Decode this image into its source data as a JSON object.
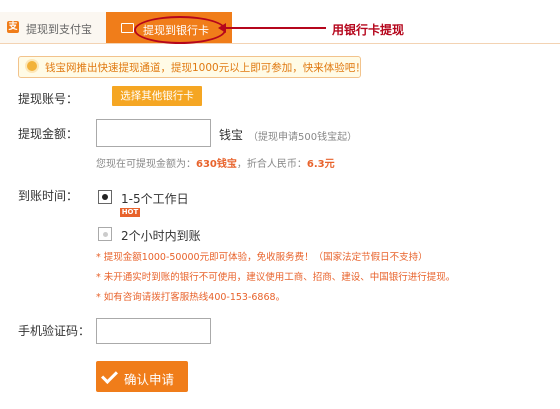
{
  "tabs": {
    "alipay": {
      "label": "提现到支付宝",
      "icon": "alipay-icon"
    },
    "bank": {
      "label": "提现到银行卡",
      "icon": "bank-card-icon",
      "active": true
    }
  },
  "annotation": {
    "text": "用银行卡提现",
    "color": "#b5061c"
  },
  "notice": {
    "text": "钱宝网推出快速提现通道，提现1000元以上即可参加，快来体验吧！",
    "icon": "sun-icon"
  },
  "form": {
    "account": {
      "label": "提现账号：",
      "button": "选择其他银行卡"
    },
    "amount": {
      "label": "提现金额：",
      "value": "",
      "unit": "钱宝",
      "hint": "（提现申请500钱宝起）",
      "available_prefix": "您现在可提现金额为：",
      "available_value": "630钱宝",
      "rmb_prefix": "，折合人民币：",
      "rmb_value": "6.3元"
    },
    "arrival": {
      "label": "到账时间：",
      "options": [
        {
          "label": "1-5个工作日",
          "selected": true,
          "badge": "HOT"
        },
        {
          "label": "2个小时内到账",
          "selected": false
        }
      ],
      "rules": [
        "* 提现金额1000-50000元即可体验，免收服务费！（国家法定节假日不支持）",
        "* 未开通实时到账的银行不可使用，建议使用工商、招商、建设、中国银行进行提现。",
        "* 如有咨询请拨打客服热线400-153-6868。"
      ]
    },
    "sms": {
      "label": "手机验证码：",
      "value": ""
    },
    "submit": {
      "label": "确认申请",
      "icon": "check-icon"
    }
  },
  "colors": {
    "accent": "#f07d1a",
    "button": "#f5a623",
    "highlight": "#e8632c"
  }
}
